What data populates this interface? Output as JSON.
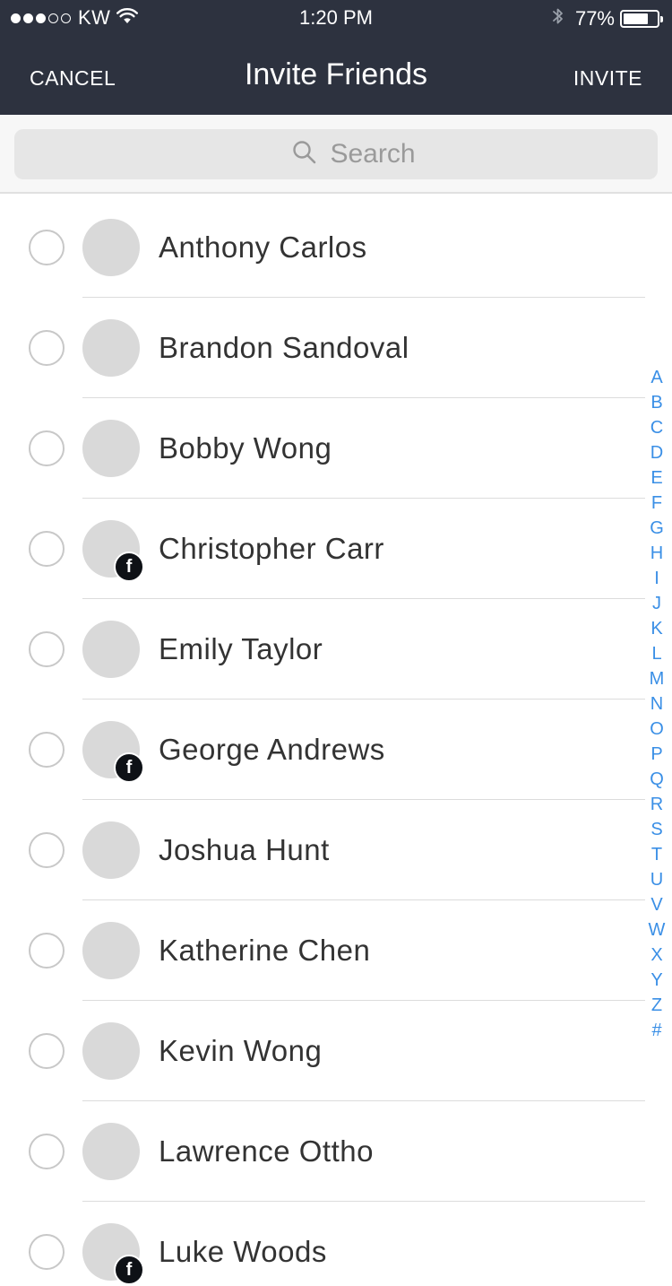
{
  "status_bar": {
    "carrier": "KW",
    "time": "1:20 PM",
    "battery_percent": "77%",
    "battery_level": 0.77,
    "signal_bars_filled": 3,
    "signal_bars_total": 5
  },
  "nav": {
    "cancel_label": "CANCEL",
    "title": "Invite Friends",
    "invite_label": "INVITE"
  },
  "search": {
    "placeholder": "Search"
  },
  "contacts": [
    {
      "name": "Anthony Carlos",
      "facebook": false
    },
    {
      "name": "Brandon Sandoval",
      "facebook": false
    },
    {
      "name": "Bobby Wong",
      "facebook": false
    },
    {
      "name": "Christopher Carr",
      "facebook": true
    },
    {
      "name": "Emily Taylor",
      "facebook": false
    },
    {
      "name": "George Andrews",
      "facebook": true
    },
    {
      "name": "Joshua Hunt",
      "facebook": false
    },
    {
      "name": "Katherine Chen",
      "facebook": false
    },
    {
      "name": "Kevin Wong",
      "facebook": false
    },
    {
      "name": "Lawrence Ottho",
      "facebook": false
    },
    {
      "name": "Luke Woods",
      "facebook": true
    }
  ],
  "facebook_badge_glyph": "f",
  "alphabet_index": [
    "A",
    "B",
    "C",
    "D",
    "E",
    "F",
    "G",
    "H",
    "I",
    "J",
    "K",
    "L",
    "M",
    "N",
    "O",
    "P",
    "Q",
    "R",
    "S",
    "T",
    "U",
    "V",
    "W",
    "X",
    "Y",
    "Z",
    "#"
  ],
  "colors": {
    "header_bg": "#2d323f",
    "index_accent": "#3a8fe6"
  }
}
